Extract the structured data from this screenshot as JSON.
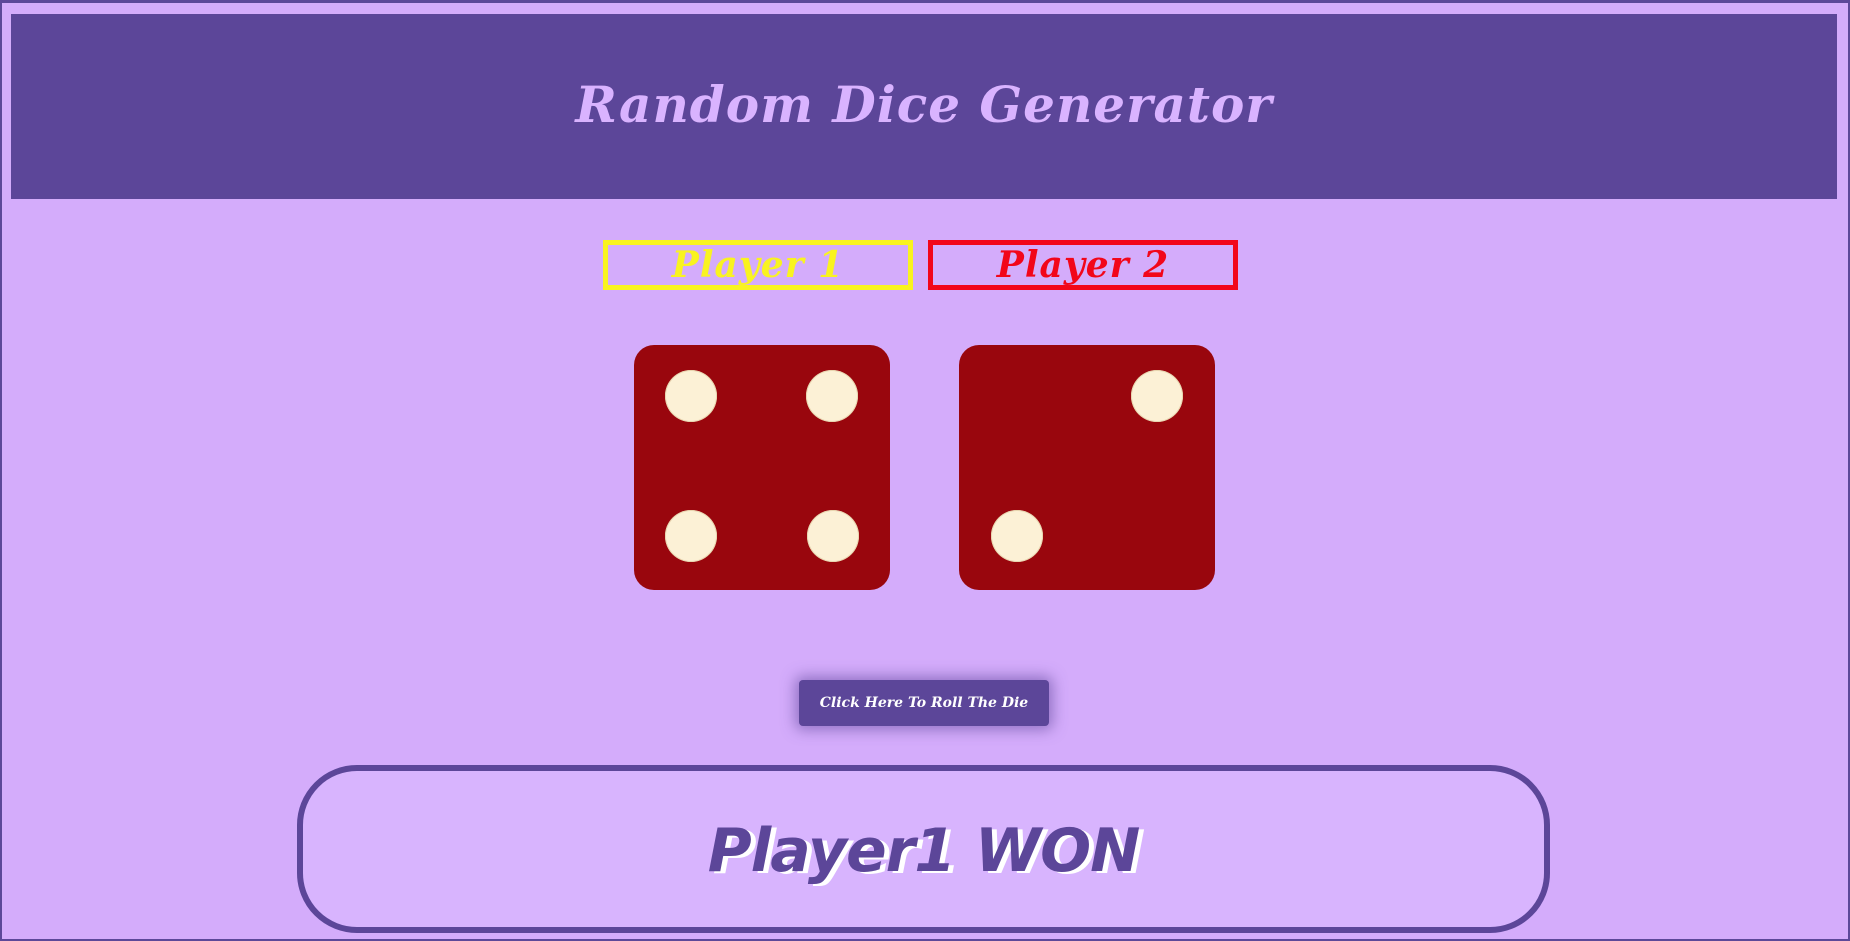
{
  "app": {
    "title": "Random Dice Generator"
  },
  "players": [
    {
      "label": "Player 1",
      "color": "#f9f320"
    },
    {
      "label": "Player 2",
      "color": "#f2061a"
    }
  ],
  "dice": [
    {
      "value": 4,
      "pips": [
        "top-left",
        "top-right",
        "bottom-left",
        "bottom-right"
      ]
    },
    {
      "value": 2,
      "pips": [
        "top-right",
        "bottom-left"
      ]
    }
  ],
  "roll_button": {
    "label": "Click Here To Roll The Die"
  },
  "result": {
    "text": "Player1 WON"
  },
  "colors": {
    "background": "#d4acfb",
    "header": "#5c4699",
    "die": "#99060d",
    "pip": "#fcf1d6"
  }
}
